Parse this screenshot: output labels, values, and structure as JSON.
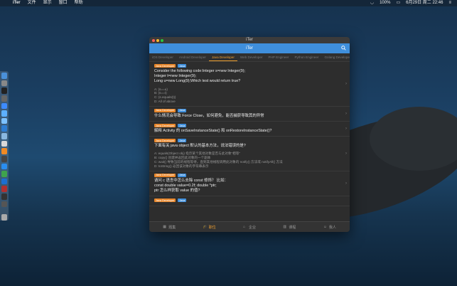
{
  "menubar": {
    "apple": "",
    "app": "iTer",
    "items": [
      "文件",
      "显示",
      "窗口",
      "帮助"
    ],
    "battery": "100%",
    "datetime": "6月29日 周二 22:46"
  },
  "window": {
    "title": "iTer",
    "nav_title": "iTer",
    "tabs": [
      "iOS Developer",
      "Android Developer",
      "Java Developer",
      "Web Developer",
      "PHP Engineer",
      "Python Engineer",
      "Golang Developer"
    ],
    "active_tab": "Java Developer"
  },
  "cards": [
    {
      "badge1": "Java Developer",
      "badge2": "Java",
      "question": "Consider the following code:Integer s=new Integer(9);\nInteger t=new Integer(9);\nLong u=new Long(9);Which test would return true?",
      "options": [
        "A: (s==u)",
        "B: (s==t)",
        "C: (s.equals(t))",
        "D: All of above"
      ]
    },
    {
      "badge1": "Java Developer",
      "badge2": "Java",
      "question": "什么情况会导致 Force Close，如何避免，能否捕获导致其的异常",
      "options": []
    },
    {
      "badge1": "Java Developer",
      "badge2": "Java",
      "question": "解释 Activity 的 onSaveInstanceState() 和 onRestoreInstanceState()?",
      "options": []
    },
    {
      "badge1": "Java Developer",
      "badge2": "Java",
      "question": "下面有关 java object 默认的基本方法，说法错误的是?",
      "options": [
        "A: equals(Object obj) 指示某个其他对象是否与此对象\"相等\"",
        "B: copy() 创建并返回此对象的一个副本",
        "C: wait() 导致当前的线程等待，直到其他线程调用此对象的 notify() 方法或 notifyAll() 方法",
        "D: toString() 返回该对象的字符串表示"
      ]
    },
    {
      "badge1": "Java Developer",
      "badge2": "Java",
      "question": "请问 c 语言中怎么去除 const 修饰？ 比如：\nconst double value=0.2f;    double *ptr;\nptr 怎么样获取 value 的值?",
      "options": []
    },
    {
      "badge1": "Java Developer",
      "badge2": "Java",
      "question": "",
      "options": []
    }
  ],
  "tabbar": {
    "items": [
      "题集",
      "职位",
      "企业",
      "课程",
      "我人"
    ],
    "active_index": 1
  },
  "colors": {
    "accent": "#3f8fdc",
    "badge_orange": "#e8862a",
    "active_tab": "#f0a030"
  },
  "icons": {
    "search": "search-icon",
    "chevron": "chevron-right-icon"
  }
}
